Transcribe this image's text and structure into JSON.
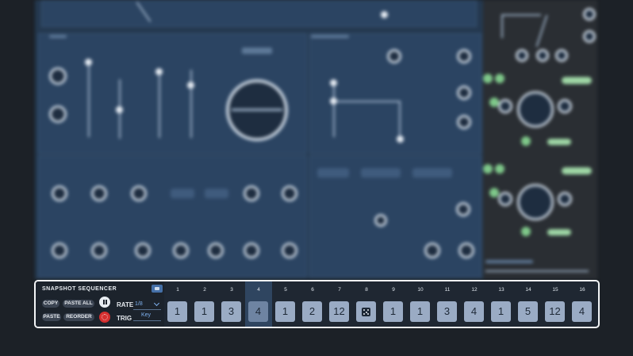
{
  "sequencer": {
    "title": "SNAPSHOT SEQUENCER",
    "buttons": {
      "copy": "COPY",
      "paste_all": "PASTE ALL",
      "paste": "PASTE",
      "reorder": "REORDER"
    },
    "rate": {
      "label": "RATE",
      "value": "1/8"
    },
    "trig": {
      "label": "TRIG",
      "value": "Key"
    },
    "highlighted_step": 4,
    "steps": [
      {
        "number": "1",
        "value": "1"
      },
      {
        "number": "2",
        "value": "1"
      },
      {
        "number": "3",
        "value": "3"
      },
      {
        "number": "4",
        "value": "4"
      },
      {
        "number": "5",
        "value": "1"
      },
      {
        "number": "6",
        "value": "2"
      },
      {
        "number": "7",
        "value": "12"
      },
      {
        "number": "8",
        "value": "",
        "icon": "dice-icon"
      },
      {
        "number": "9",
        "value": "1"
      },
      {
        "number": "10",
        "value": "1"
      },
      {
        "number": "11",
        "value": "3"
      },
      {
        "number": "12",
        "value": "4"
      },
      {
        "number": "13",
        "value": "1"
      },
      {
        "number": "14",
        "value": "5"
      },
      {
        "number": "15",
        "value": "12"
      },
      {
        "number": "16",
        "value": "4"
      }
    ]
  },
  "colors": {
    "border": "#f3f5f7",
    "accent": "#7fb2f0",
    "record": "#d52f2f",
    "step_button": "#9aabc4"
  }
}
